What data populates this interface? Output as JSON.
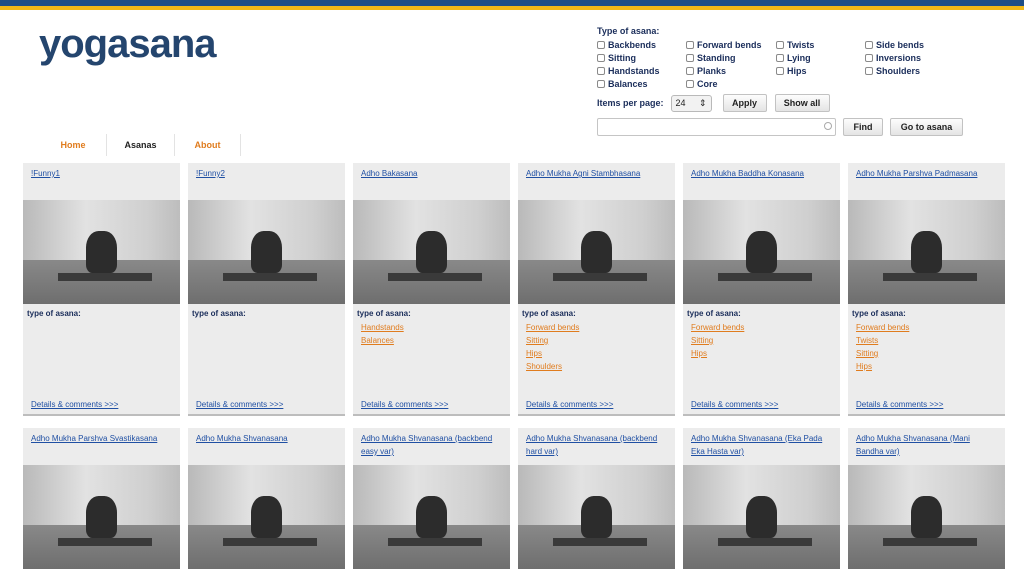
{
  "brand": {
    "logo": "yogasana",
    "blue": "#1f4e86",
    "gold": "#f2b817",
    "orange": "#e07c1e"
  },
  "filters": {
    "title": "Type of asana:",
    "options": [
      "Backbends",
      "Forward bends",
      "Twists",
      "Side bends",
      "Sitting",
      "Standing",
      "Lying",
      "Inversions",
      "Handstands",
      "Planks",
      "Hips",
      "Shoulders",
      "Balances",
      "Core"
    ],
    "items_per_page_label": "Items per page:",
    "items_per_page_value": "24",
    "apply_label": "Apply",
    "show_all_label": "Show all"
  },
  "search": {
    "placeholder": "",
    "find_label": "Find",
    "goto_label": "Go to asana"
  },
  "nav": {
    "home": "Home",
    "asanas": "Asanas",
    "about": "About"
  },
  "card_labels": {
    "type_of_asana": "type of asana:",
    "details": "Details & comments >>>"
  },
  "asanas": [
    {
      "name": "!Funny1",
      "types": []
    },
    {
      "name": "!Funny2",
      "types": []
    },
    {
      "name": "Adho Bakasana",
      "types": [
        "Handstands",
        "Balances"
      ]
    },
    {
      "name": "Adho Mukha Agni Stambhasana",
      "types": [
        "Forward bends",
        "Sitting",
        "Hips",
        "Shoulders"
      ]
    },
    {
      "name": "Adho Mukha Baddha Konasana",
      "types": [
        "Forward bends",
        "Sitting",
        "Hips"
      ]
    },
    {
      "name": "Adho Mukha Parshva Padmasana",
      "types": [
        "Forward bends",
        "Twists",
        "Sitting",
        "Hips"
      ]
    },
    {
      "name": "Adho Mukha Parshva Svastikasana",
      "types": []
    },
    {
      "name": "Adho Mukha Shvanasana",
      "types": []
    },
    {
      "name": "Adho Mukha Shvanasana (backbend easy var)",
      "types": []
    },
    {
      "name": "Adho Mukha Shvanasana (backbend hard var)",
      "types": []
    },
    {
      "name": "Adho Mukha Shvanasana (Eka Pada Eka Hasta var)",
      "types": []
    },
    {
      "name": "Adho Mukha Shvanasana (Mani Bandha var)",
      "types": []
    }
  ]
}
